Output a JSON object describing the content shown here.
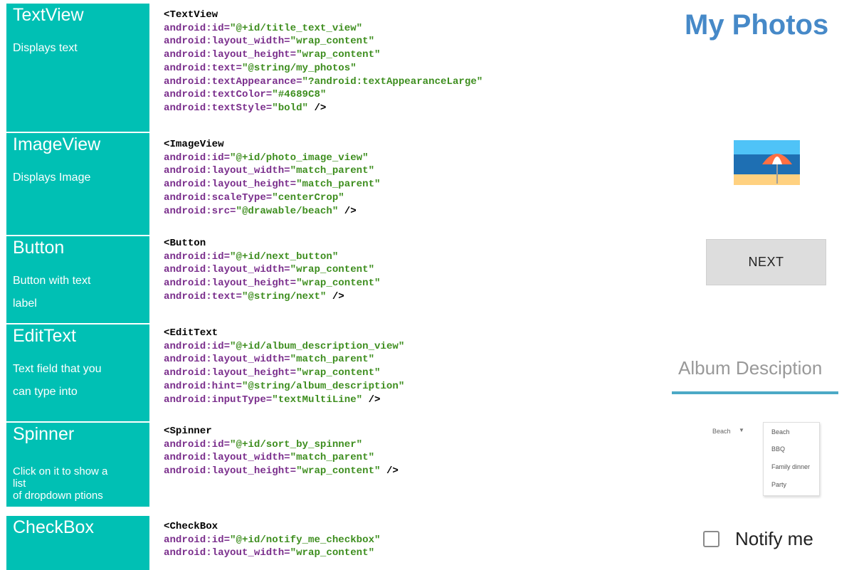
{
  "rows": [
    {
      "title": "TextView",
      "description": [
        "Displays text"
      ],
      "code_open": "<TextView",
      "attrs": [
        {
          "name": "android:id=",
          "value": "\"@+id/title_text_view\""
        },
        {
          "name": "android:layout_width=",
          "value": "\"wrap_content\""
        },
        {
          "name": "android:layout_height=",
          "value": "\"wrap_content\""
        },
        {
          "name": "android:text=",
          "value": "\"@string/my_photos\""
        },
        {
          "name": "android:textAppearance=",
          "value": "\"?android:textAppearanceLarge\""
        },
        {
          "name": "android:textColor=",
          "value": "\"#4689C8\""
        },
        {
          "name": "android:textStyle=",
          "value": "\"bold\"",
          "close": " />"
        }
      ]
    },
    {
      "title": "ImageView",
      "description": [
        "Displays Image"
      ],
      "code_open": "<ImageView",
      "attrs": [
        {
          "name": "android:id=",
          "value": "\"@+id/photo_image_view\""
        },
        {
          "name": "android:layout_width=",
          "value": "\"match_parent\""
        },
        {
          "name": "android:layout_height=",
          "value": "\"match_parent\""
        },
        {
          "name": "android:scaleType=",
          "value": "\"centerCrop\""
        },
        {
          "name": "android:src=",
          "value": "\"@drawable/beach\"",
          "close": " />"
        }
      ]
    },
    {
      "title": "Button",
      "description": [
        "Button with text",
        "label"
      ],
      "code_open": "<Button",
      "attrs": [
        {
          "name": "android:id=",
          "value": "\"@+id/next_button\""
        },
        {
          "name": "android:layout_width=",
          "value": "\"wrap_content\""
        },
        {
          "name": "android:layout_height=",
          "value": "\"wrap_content\""
        },
        {
          "name": "android:text=",
          "value": "\"@string/next\"",
          "close": " />"
        }
      ]
    },
    {
      "title": "EditText",
      "description": [
        "Text field that you",
        "can type into"
      ],
      "code_open": "<EditText",
      "attrs": [
        {
          "name": "android:id=",
          "value": "\"@+id/album_description_view\""
        },
        {
          "name": "android:layout_width=",
          "value": "\"match_parent\""
        },
        {
          "name": "android:layout_height=",
          "value": "\"wrap_content\""
        },
        {
          "name": "android:hint=",
          "value": "\"@string/album_description\""
        },
        {
          "name": "android:inputType=",
          "value": "\"textMultiLine\"",
          "close": " />"
        }
      ]
    },
    {
      "title": "Spinner",
      "description": [
        "Click on it to show a",
        "list",
        "of dropdown ptions"
      ],
      "code_open": "<Spinner",
      "attrs": [
        {
          "name": "android:id=",
          "value": "\"@+id/sort_by_spinner\""
        },
        {
          "name": "android:layout_width=",
          "value": "\"match_parent\""
        },
        {
          "name": "android:layout_height=",
          "value": "\"wrap_content\"",
          "close": " />"
        }
      ]
    },
    {
      "title": "CheckBox",
      "description": [],
      "code_open": "<CheckBox",
      "attrs": [
        {
          "name": "android:id=",
          "value": "\"@+id/notify_me_checkbox\""
        },
        {
          "name": "android:layout_width=",
          "value": "\"wrap_content\""
        }
      ]
    }
  ],
  "preview": {
    "title_text": "My Photos",
    "title_color": "#4689C8",
    "image_icon": "beach-umbrella-icon",
    "button_label": "NEXT",
    "edit_hint": "Album Desciption",
    "spinner_selected": "Beach",
    "spinner_options": [
      "Beach",
      "BBQ",
      "Family dinner",
      "Party"
    ],
    "checkbox_label": "Notify me",
    "checkbox_checked": false
  },
  "colors": {
    "label_background": "#00C0B4",
    "code_attribute": "#7A2E8C",
    "code_value": "#3E8E1F",
    "edit_underline": "#4CA9C6"
  }
}
